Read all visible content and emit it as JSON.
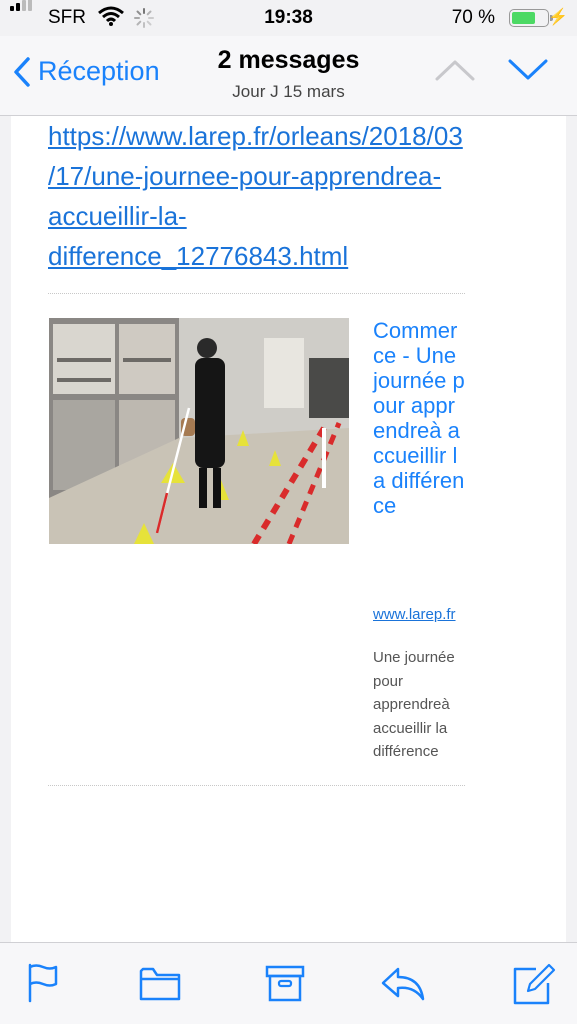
{
  "status": {
    "carrier": "SFR",
    "time": "19:38",
    "battery_pct": "70 %",
    "battery_level": 0.7,
    "battery_color": "#4cd964"
  },
  "nav": {
    "back_label": "Réception",
    "title": "2 messages",
    "subtitle": "Jour J 15 mars",
    "icons": [
      "chevron-left-icon",
      "chevron-up-icon",
      "chevron-down-icon"
    ]
  },
  "email": {
    "url": "https://www.larep.fr/orleans/2018/03/17/une-journee-pour-apprendrea-accueillir-la-difference_12776843.html",
    "link_card": {
      "title": "Commerce - Une journée pour apprendreà accueillir la différence",
      "domain": "www.larep.fr",
      "description": "Une journée pour apprendreà accueillir la différence"
    }
  },
  "toolbar": {
    "icons": [
      "flag-icon",
      "folder-icon",
      "archive-icon",
      "reply-icon",
      "compose-icon"
    ]
  },
  "colors": {
    "accent": "#1a82fb",
    "link": "#1a73d9"
  }
}
